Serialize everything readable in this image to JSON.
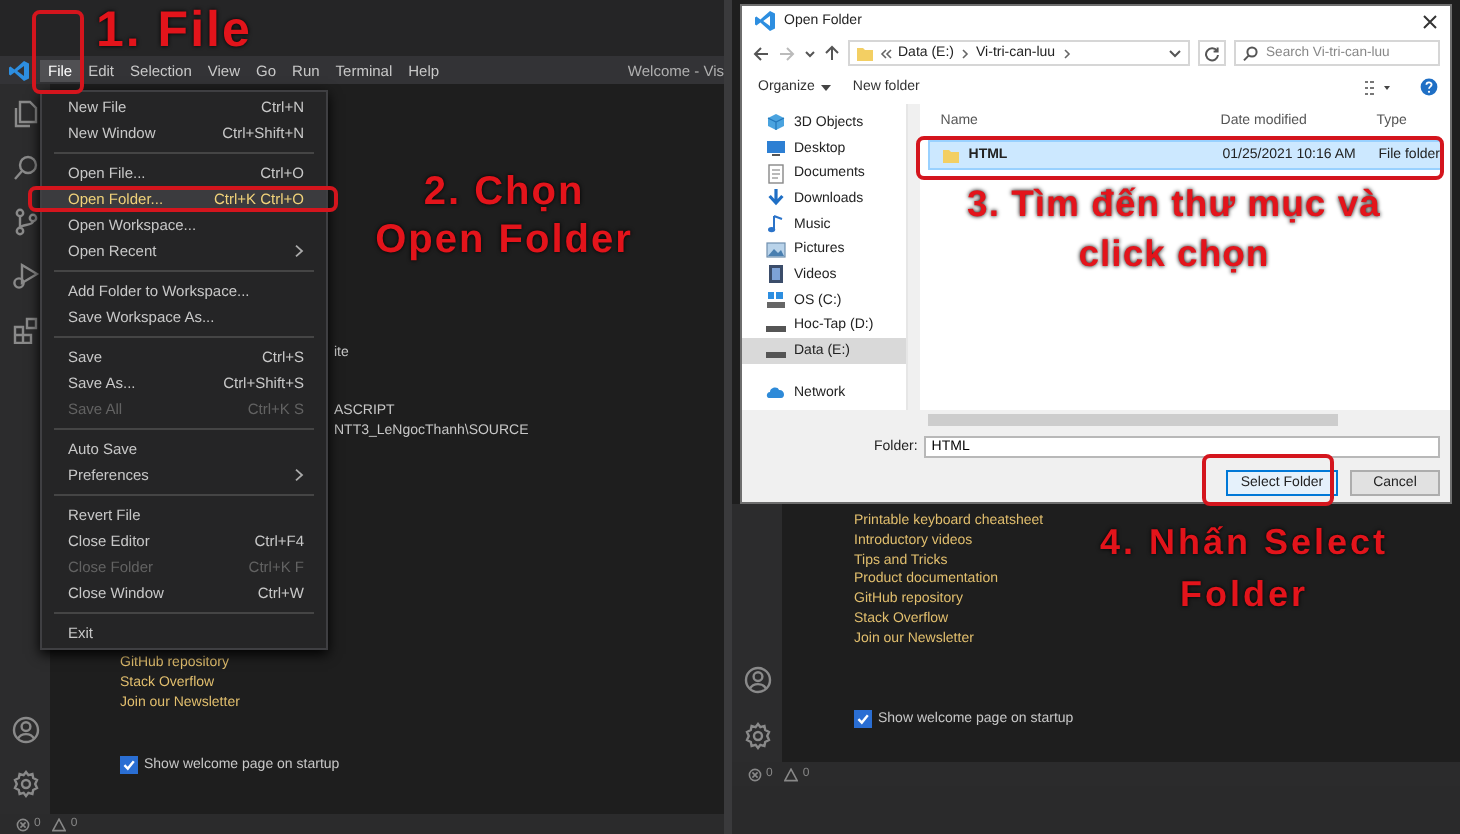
{
  "annotations": [
    {
      "lines": [
        "1. File"
      ]
    },
    {
      "lines": [
        "2. Chọn",
        "Open Folder"
      ]
    },
    {
      "lines": [
        "3. Tìm đến thư mục và",
        "click chọn"
      ]
    },
    {
      "lines": [
        "4. Nhấn Select",
        "Folder"
      ]
    }
  ],
  "left_screen": {
    "menu_bar": {
      "items": [
        {
          "label": "File",
          "selected": true
        },
        {
          "label": "Edit",
          "selected": false
        },
        {
          "label": "Selection",
          "selected": false
        },
        {
          "label": "View",
          "selected": false
        },
        {
          "label": "Go",
          "selected": false
        },
        {
          "label": "Run",
          "selected": false
        },
        {
          "label": "Terminal",
          "selected": false
        },
        {
          "label": "Help",
          "selected": false
        }
      ],
      "window_title": "Welcome - Vis"
    },
    "file_menu": {
      "groups": [
        {
          "items": [
            {
              "label": "New File",
              "shortcut": "Ctrl+N",
              "disabled": false,
              "highlighted": false
            },
            {
              "label": "New Window",
              "shortcut": "Ctrl+Shift+N",
              "disabled": false,
              "highlighted": false
            }
          ]
        },
        {
          "items": [
            {
              "label": "Open File...",
              "shortcut": "Ctrl+O",
              "disabled": false,
              "highlighted": false
            },
            {
              "label": "Open Folder...",
              "shortcut": "Ctrl+K Ctrl+O",
              "disabled": false,
              "highlighted": true
            },
            {
              "label": "Open Workspace...",
              "disabled": false,
              "highlighted": false
            },
            {
              "label": "Open Recent",
              "submenu": true,
              "disabled": false,
              "highlighted": false
            }
          ]
        },
        {
          "items": [
            {
              "label": "Add Folder to Workspace...",
              "disabled": false,
              "highlighted": false
            },
            {
              "label": "Save Workspace As...",
              "disabled": false,
              "highlighted": false
            }
          ]
        },
        {
          "items": [
            {
              "label": "Save",
              "shortcut": "Ctrl+S",
              "disabled": false,
              "highlighted": false
            },
            {
              "label": "Save As...",
              "shortcut": "Ctrl+Shift+S",
              "disabled": false,
              "highlighted": false
            },
            {
              "label": "Save All",
              "shortcut": "Ctrl+K S",
              "disabled": true,
              "highlighted": false
            }
          ]
        },
        {
          "items": [
            {
              "label": "Auto Save",
              "disabled": false,
              "highlighted": false
            },
            {
              "label": "Preferences",
              "submenu": true,
              "disabled": false,
              "highlighted": false
            }
          ]
        },
        {
          "items": [
            {
              "label": "Revert File",
              "disabled": false,
              "highlighted": false
            },
            {
              "label": "Close Editor",
              "shortcut": "Ctrl+F4",
              "disabled": false,
              "highlighted": false
            },
            {
              "label": "Close Folder",
              "shortcut": "Ctrl+K F",
              "disabled": true,
              "highlighted": false
            },
            {
              "label": "Close Window",
              "shortcut": "Ctrl+W",
              "disabled": false,
              "highlighted": false
            }
          ]
        },
        {
          "items": [
            {
              "label": "Exit",
              "disabled": false,
              "highlighted": false
            }
          ]
        }
      ]
    },
    "editor": {
      "fragments": [
        "ite",
        "ASCRIPT",
        "NTT3_LeNgocThanh\\SOURCE"
      ],
      "links": [
        "GitHub repository",
        "Stack Overflow",
        "Join our Newsletter"
      ],
      "startup_checkbox": {
        "label": "Show welcome page on startup",
        "checked": true
      }
    },
    "status_bar": {
      "errors": "0",
      "warnings": "0"
    }
  },
  "right_screen": {
    "dialog": {
      "title": "Open Folder",
      "path": [
        "Data (E:)",
        "Vi-tri-can-luu"
      ],
      "search": {
        "placeholder": "Search Vi-tri-can-luu"
      },
      "toolbar": [
        "Organize",
        "New folder"
      ],
      "nav_items": [
        {
          "label": "3D Objects",
          "kind": "objects",
          "selected": false
        },
        {
          "label": "Desktop",
          "kind": "desktop",
          "selected": false
        },
        {
          "label": "Documents",
          "kind": "documents",
          "selected": false
        },
        {
          "label": "Downloads",
          "kind": "downloads",
          "selected": false
        },
        {
          "label": "Music",
          "kind": "music",
          "selected": false
        },
        {
          "label": "Pictures",
          "kind": "pictures",
          "selected": false
        },
        {
          "label": "Videos",
          "kind": "videos",
          "selected": false
        },
        {
          "label": "OS (C:)",
          "kind": "system_drive",
          "selected": false
        },
        {
          "label": "Hoc-Tap (D:)",
          "kind": "drive",
          "selected": false
        },
        {
          "label": "Data (E:)",
          "kind": "drive",
          "selected": true
        },
        {
          "label": "Network",
          "kind": "network",
          "selected": false
        }
      ],
      "columns": [
        "Name",
        "Date modified",
        "Type"
      ],
      "rows": [
        {
          "name": "HTML",
          "date": "01/25/2021 10:16 AM",
          "type": "File folder",
          "selected": true
        }
      ],
      "folder_field": {
        "label": "Folder:",
        "value": "HTML"
      },
      "buttons": [
        {
          "label": "Select Folder",
          "default": true
        },
        {
          "label": "Cancel",
          "default": false
        }
      ]
    },
    "editor": {
      "links": [
        "Printable keyboard cheatsheet",
        "Introductory videos",
        "Tips and Tricks",
        "Product documentation",
        "GitHub repository",
        "Stack Overflow",
        "Join our Newsletter"
      ],
      "startup_checkbox": {
        "label": "Show welcome page on startup",
        "checked": true
      }
    },
    "status_bar": {
      "errors": "0",
      "warnings": "0"
    }
  }
}
